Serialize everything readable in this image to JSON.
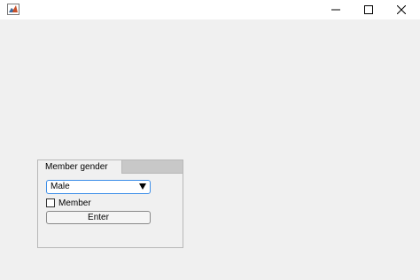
{
  "window": {
    "icon": "matlab-figure-icon",
    "controls": {
      "minimize": "minimize-icon",
      "maximize": "maximize-icon",
      "close": "close-icon"
    }
  },
  "tabgroup": {
    "tabs": [
      {
        "label": "Member gender"
      }
    ]
  },
  "form": {
    "gender_dropdown": {
      "selected": "Male"
    },
    "member_checkbox": {
      "label": "Member",
      "checked": false
    },
    "enter_button": {
      "label": "Enter"
    }
  },
  "colors": {
    "background": "#f0f0f0",
    "dropdown_border": "#3c8ee8"
  }
}
